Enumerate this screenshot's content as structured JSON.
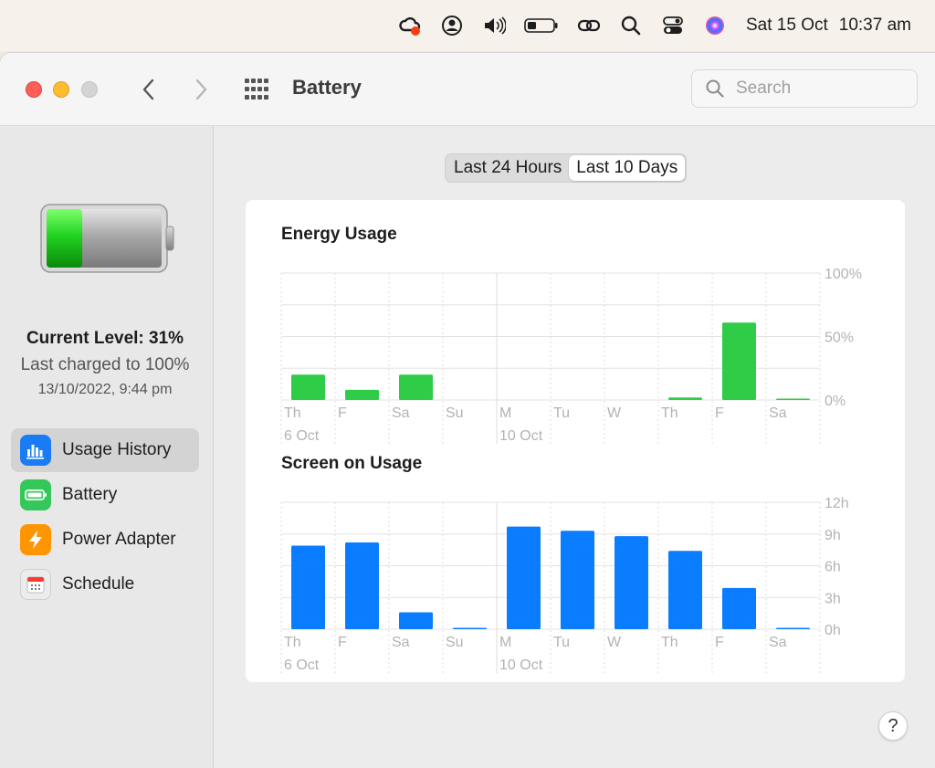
{
  "menubar": {
    "date": "Sat 15 Oct",
    "time": "10:37 am",
    "icons": [
      "creative-cloud-icon",
      "user-account-icon",
      "volume-icon",
      "battery-status-icon",
      "link-icon",
      "spotlight-search-icon",
      "control-center-icon",
      "siri-icon"
    ]
  },
  "window": {
    "title": "Battery",
    "search_placeholder": "Search"
  },
  "sidebar": {
    "current_level": "Current Level: 31%",
    "last_charged": "Last charged to 100%",
    "charge_date": "13/10/2022, 9:44 pm",
    "battery_level": 0.31,
    "items": [
      {
        "label": "Usage History",
        "icon": "usage-history-icon",
        "color": "#1a7cf5",
        "active": true
      },
      {
        "label": "Battery",
        "icon": "battery-icon",
        "color": "#34c759",
        "active": false
      },
      {
        "label": "Power Adapter",
        "icon": "power-adapter-icon",
        "color": "#ff9500",
        "active": false
      },
      {
        "label": "Schedule",
        "icon": "schedule-icon",
        "color": "#e5e5e5",
        "active": false
      }
    ]
  },
  "segmented": {
    "options": [
      "Last 24 Hours",
      "Last 10 Days"
    ],
    "selected": 1
  },
  "help_label": "?",
  "chart_data": [
    {
      "type": "bar",
      "title": "Energy Usage",
      "categories": [
        "Th",
        "F",
        "Sa",
        "Su",
        "M",
        "Tu",
        "W",
        "Th",
        "F",
        "Sa"
      ],
      "date_labels": [
        {
          "index": 0,
          "label": "6 Oct"
        },
        {
          "index": 4,
          "label": "10 Oct"
        }
      ],
      "values": [
        20,
        8,
        20,
        0,
        0,
        0,
        0,
        2,
        61,
        1
      ],
      "ylim": [
        0,
        100
      ],
      "yticks": [
        "100%",
        "50%",
        "0%"
      ],
      "ytick_values": [
        100,
        50,
        0
      ],
      "grid_steps": 4,
      "color": "#2ecc47"
    },
    {
      "type": "bar",
      "title": "Screen on Usage",
      "categories": [
        "Th",
        "F",
        "Sa",
        "Su",
        "M",
        "Tu",
        "W",
        "Th",
        "F",
        "Sa"
      ],
      "date_labels": [
        {
          "index": 0,
          "label": "6 Oct"
        },
        {
          "index": 4,
          "label": "10 Oct"
        }
      ],
      "values": [
        7.9,
        8.2,
        1.6,
        0.1,
        9.7,
        9.3,
        8.8,
        7.4,
        3.9,
        0.1
      ],
      "ylim": [
        0,
        12
      ],
      "yticks": [
        "12h",
        "9h",
        "6h",
        "3h",
        "0h"
      ],
      "ytick_values": [
        12,
        9,
        6,
        3,
        0
      ],
      "grid_steps": 4,
      "color": "#0a7cff"
    }
  ]
}
